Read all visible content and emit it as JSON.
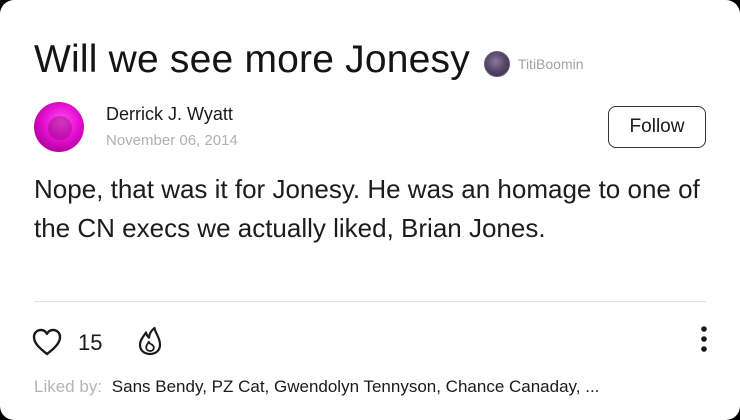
{
  "post": {
    "title": "Will we see more Jonesy",
    "asker_name": "TitiBoomin",
    "author_name": "Derrick J. Wyatt",
    "date": "November 06, 2014",
    "follow_label": "Follow",
    "answer": "Nope, that was it for Jonesy. He was an homage to one of the CN execs we actually liked, Brian Jones."
  },
  "reactions": {
    "like_count": "15",
    "liked_by_label": "Liked by:",
    "liked_by_names": "Sans Bendy, PZ Cat, Gwendolyn Tennyson, Chance Canaday, ..."
  },
  "icons": {
    "like": "heart-icon",
    "fire": "fire-icon",
    "more": "more-vertical-icon"
  },
  "colors": {
    "author_avatar": "#e812d6",
    "muted_text": "#b0b0b0"
  }
}
